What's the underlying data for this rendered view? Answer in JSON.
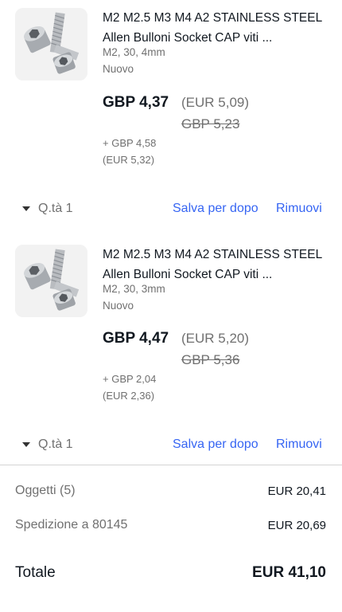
{
  "items": [
    {
      "title": "M2 M2.5 M3 M4 A2 STAINLESS STEEL Allen Bulloni Socket CAP viti ...",
      "variant": "M2, 30, 4mm",
      "condition": "Nuovo",
      "price": "GBP 4,37",
      "price_converted": "(EUR 5,09)",
      "price_original": "GBP 5,23",
      "shipping": "+ GBP 4,58",
      "shipping_converted": "(EUR 5,32)",
      "qty_label": "Q.tà 1",
      "save_label": "Salva per dopo",
      "remove_label": "Rimuovi",
      "image_icon": "socket-cap-screw-image"
    },
    {
      "title": "M2 M2.5 M3 M4 A2 STAINLESS STEEL Allen Bulloni Socket CAP viti ...",
      "variant": "M2, 30, 3mm",
      "condition": "Nuovo",
      "price": "GBP 4,47",
      "price_converted": "(EUR 5,20)",
      "price_original": "GBP 5,36",
      "shipping": "+ GBP 2,04",
      "shipping_converted": "(EUR 2,36)",
      "qty_label": "Q.tà 1",
      "save_label": "Salva per dopo",
      "remove_label": "Rimuovi",
      "image_icon": "socket-cap-screw-image"
    }
  ],
  "summary": {
    "items_label": "Oggetti (5)",
    "items_value": "EUR 20,41",
    "shipping_label": "Spedizione a 80145",
    "shipping_value": "EUR 20,69",
    "total_label": "Totale",
    "total_value": "EUR 41,10"
  },
  "colors": {
    "link": "#3665f3",
    "text": "#111820",
    "muted": "#707070"
  }
}
